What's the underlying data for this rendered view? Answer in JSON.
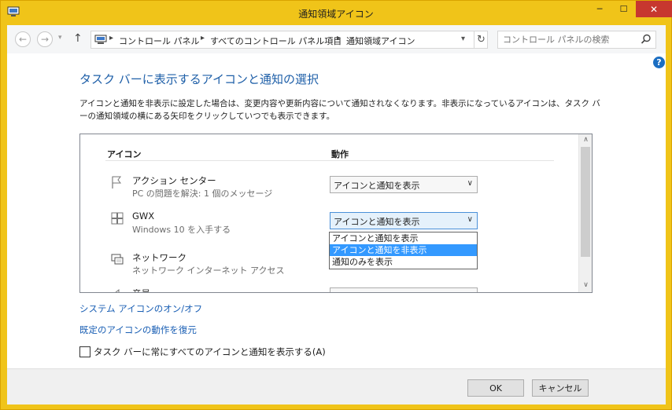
{
  "window": {
    "title": "通知領域アイコン",
    "minimize": "─",
    "maximize": "☐",
    "close": "✕"
  },
  "nav": {
    "back": "←",
    "forward": "→",
    "recent": "▾",
    "up": "↑",
    "breadcrumbs": [
      "コントロール パネル",
      "すべてのコントロール パネル項目",
      "通知領域アイコン"
    ],
    "separator": "▸",
    "refresh": "↻",
    "search_placeholder": "コントロール パネルの検索"
  },
  "help": "?",
  "heading": "タスク バーに表示するアイコンと通知の選択",
  "description": "アイコンと通知を非表示に設定した場合は、変更内容や更新内容について通知されなくなります。非表示になっているアイコンは、タスク バーの通知領域の横にある矢印をクリックしていつでも表示できます。",
  "table": {
    "col_icon": "アイコン",
    "col_action": "動作",
    "rows": [
      {
        "name": "アクション センター",
        "sub": "PC の問題を解決: 1 個のメッセージ",
        "value": "アイコンと通知を表示",
        "icon": "flag-icon"
      },
      {
        "name": "GWX",
        "sub": "Windows 10 を入手する",
        "value": "アイコンと通知を表示",
        "icon": "windows-logo-icon"
      },
      {
        "name": "ネットワーク",
        "sub": "ネットワーク インターネット アクセス",
        "value": "",
        "icon": "network-icon"
      },
      {
        "name": "音量",
        "sub": "",
        "value": "",
        "icon": "speaker-icon"
      }
    ],
    "dropdown_options": [
      "アイコンと通知を表示",
      "アイコンと通知を非表示",
      "通知のみを表示"
    ],
    "highlighted_option": 1
  },
  "links": {
    "system_icons": "システム アイコンのオン/オフ",
    "restore": "既定のアイコンの動作を復元"
  },
  "checkbox": {
    "label": "タスク バーに常にすべてのアイコンと通知を表示する(A)",
    "checked": false
  },
  "buttons": {
    "ok": "OK",
    "cancel": "キャンセル"
  },
  "colors": {
    "titlebar": "#f0c419",
    "heading": "#1e5fa8",
    "link": "#1a5fb4",
    "highlight": "#3399ff",
    "close": "#c7372f"
  }
}
